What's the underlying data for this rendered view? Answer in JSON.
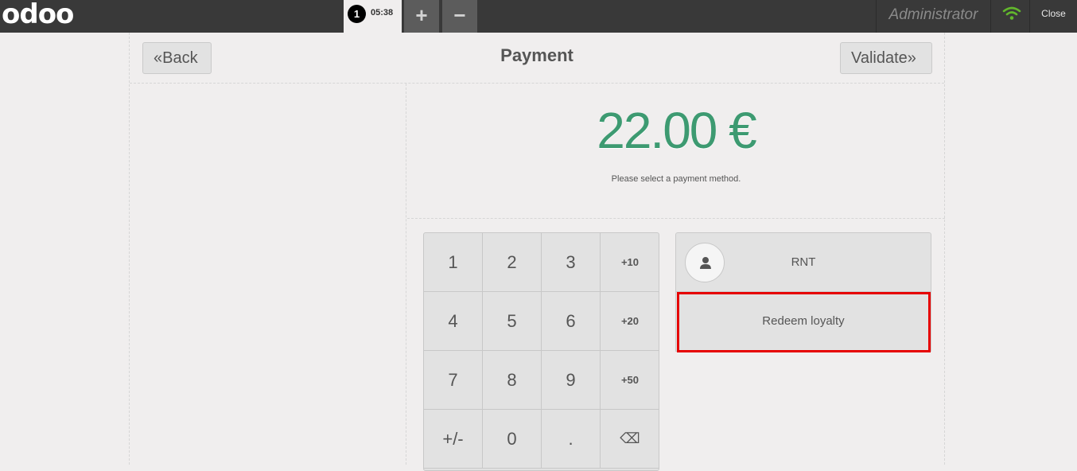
{
  "topbar": {
    "logo": "odoo",
    "order": {
      "number": "1",
      "time": "05:38"
    },
    "add_label": "+",
    "remove_label": "−",
    "user": "Administrator",
    "close_label": "Close"
  },
  "payment_screen": {
    "back_label": "Back",
    "title": "Payment",
    "validate_label": "Validate",
    "amount": "22.00 €",
    "instructions": "Please select a payment method."
  },
  "numpad": {
    "keys": [
      "1",
      "2",
      "3",
      "+10",
      "4",
      "5",
      "6",
      "+20",
      "7",
      "8",
      "9",
      "+50",
      "+/-",
      "0",
      ".",
      "⌫"
    ]
  },
  "payment_methods": [
    {
      "label": "RNT",
      "icon": "user-icon"
    },
    {
      "label": "Redeem loyalty"
    }
  ],
  "colors": {
    "topbar": "#393939",
    "amount": "#3d9a71",
    "highlight": "#e60000",
    "wifi": "#62b72c"
  }
}
